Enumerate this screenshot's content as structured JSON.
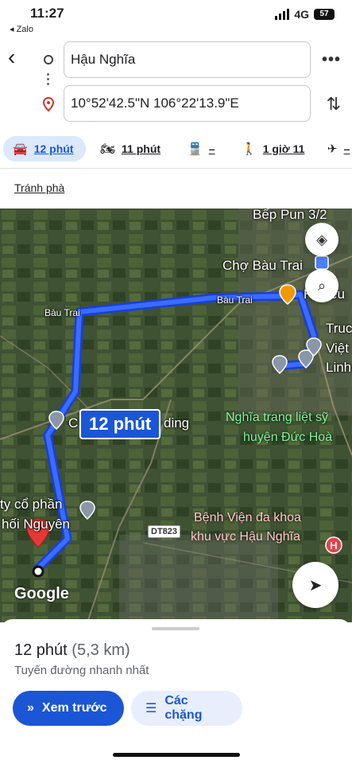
{
  "status": {
    "time": "11:27",
    "back_app": "◂ Zalo",
    "network": "4G",
    "battery": "57"
  },
  "route": {
    "from": "Hậu Nghĩa",
    "to": "10°52'42.5\"N 106°22'13.9\"E"
  },
  "modes": [
    {
      "icon": "car-icon",
      "label": "12 phút",
      "active": true
    },
    {
      "icon": "motorbike-icon",
      "label": "11 phút"
    },
    {
      "icon": "transit-icon",
      "label": "–"
    },
    {
      "icon": "walk-icon",
      "label": "1 giờ 11"
    },
    {
      "icon": "flight-icon",
      "label": "–"
    }
  ],
  "avoid_ferries": "Tránh phà",
  "map": {
    "labels": {
      "bep_pun": "Bếp Pun 3/2",
      "cho_bau_trai": "Chợ Bàu Trai",
      "bau_trai_left": "Bàu Trai",
      "bau_trai_right": "Bàu Trai",
      "h_hieu": "H Hiếu",
      "truong": "Truc",
      "viet": "Việt",
      "linh": "Linh",
      "c_building": "C",
      "building": "ding",
      "nghia_trang": "Nghĩa trang liệt sỹ",
      "huyen_duc_hoa": "huyện Đức Hoà",
      "cong_ty": "ty cổ phần",
      "noi_nguyen": "hối Nguyên",
      "benh_vien": "Bệnh Viện đa khoa",
      "khu_vuc": "khu vực Hậu Nghĩa",
      "road": "DT823",
      "google": "Google"
    },
    "route_time": "12 phút"
  },
  "sheet": {
    "duration": "12 phút",
    "distance": "(5,3 km)",
    "description": "Tuyến đường nhanh nhất",
    "preview_button": "Xem trước",
    "steps_button": "Các chặng"
  }
}
